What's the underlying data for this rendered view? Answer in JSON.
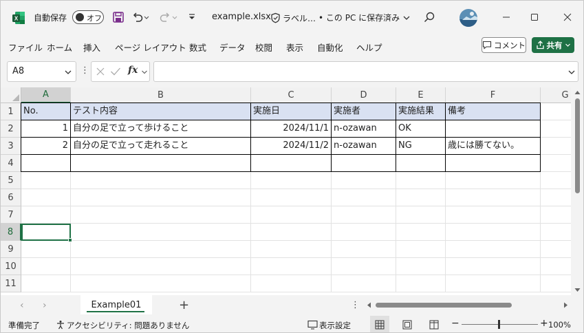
{
  "titlebar": {
    "autosave_label": "自動保存",
    "autosave_state": "オフ",
    "filename": "example.xlsx",
    "sensitivity_label": "ラベル…",
    "save_status": "• この PC に保存済み",
    "accent_color": "#1e7145"
  },
  "menu": {
    "items": [
      "ファイル",
      "ホーム",
      "挿入",
      "ページ レイアウト",
      "数式",
      "データ",
      "校閲",
      "表示",
      "自動化",
      "ヘルプ"
    ],
    "comment_label": "コメント",
    "share_label": "共有"
  },
  "formula_bar": {
    "name_box": "A8",
    "fx_label": "fx",
    "formula": ""
  },
  "grid": {
    "columns": [
      "A",
      "B",
      "C",
      "D",
      "E",
      "F",
      "G"
    ],
    "rows": [
      "1",
      "2",
      "3",
      "4",
      "5",
      "6",
      "7",
      "8",
      "9",
      "10",
      "11"
    ],
    "header_fill": "#d9e1f2",
    "table": {
      "headers": [
        "No.",
        "テスト内容",
        "実施日",
        "実施者",
        "実施結果",
        "備考"
      ],
      "rows": [
        [
          "1",
          "自分の足で立って歩けること",
          "2024/11/1",
          "n-ozawan",
          "OK",
          ""
        ],
        [
          "2",
          "自分の足で立って走れること",
          "2024/11/2",
          "n-ozawan",
          "NG",
          "歳には勝てない。"
        ],
        [
          "",
          "",
          "",
          "",
          "",
          ""
        ]
      ]
    }
  },
  "sheets": {
    "active": "Example01"
  },
  "status": {
    "ready": "準備完了",
    "accessibility": "アクセシビリティ: 問題ありません",
    "display_settings": "表示設定",
    "zoom": "100%"
  }
}
